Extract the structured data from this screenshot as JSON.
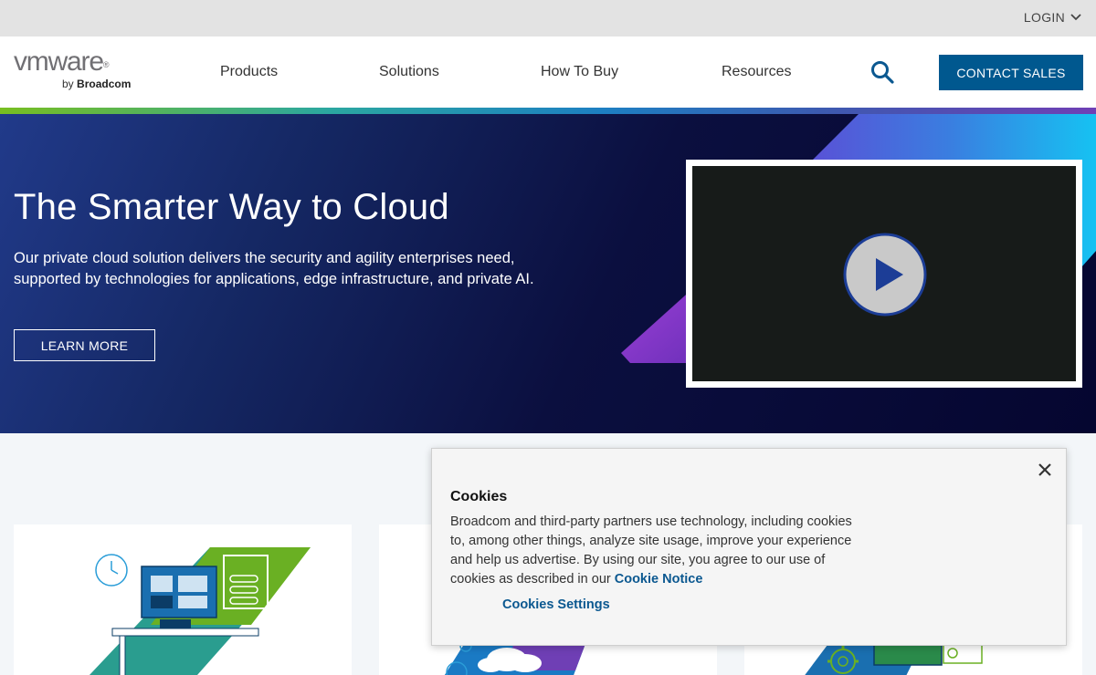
{
  "utility_bar": {
    "login_label": "LOGIN"
  },
  "header": {
    "logo": {
      "word": "vmware",
      "mark": "®",
      "by": "by",
      "brand": "Broadcom"
    },
    "nav": [
      {
        "label": "Products"
      },
      {
        "label": "Solutions"
      },
      {
        "label": "How To Buy"
      },
      {
        "label": "Resources"
      }
    ],
    "contact_label": "CONTACT SALES"
  },
  "hero": {
    "title": "The Smarter Way to Cloud",
    "description": "Our private cloud solution delivers the security and agility enterprises need, supported by technologies for applications, edge infrastructure, and private AI.",
    "learn_more_label": "LEARN MORE"
  },
  "cookie_dialog": {
    "title": "Cookies",
    "text": "Broadcom and third-party partners use technology, including cookies to, among other things, analyze site usage, improve your experience and help us advertise. By using our site, you agree to our use of cookies as described in our",
    "notice_link": "Cookie Notice",
    "settings_label": "Cookies Settings"
  },
  "colors": {
    "primary_blue": "#00588f",
    "hero_dark": "#050630",
    "accent_purple": "#7b3fc4",
    "accent_green": "#78be20",
    "link_blue": "#0b5890"
  },
  "icons": [
    "chevron-down-icon",
    "search-icon",
    "play-icon",
    "close-icon",
    "clock-icon",
    "cloud-icon",
    "gear-icon"
  ]
}
